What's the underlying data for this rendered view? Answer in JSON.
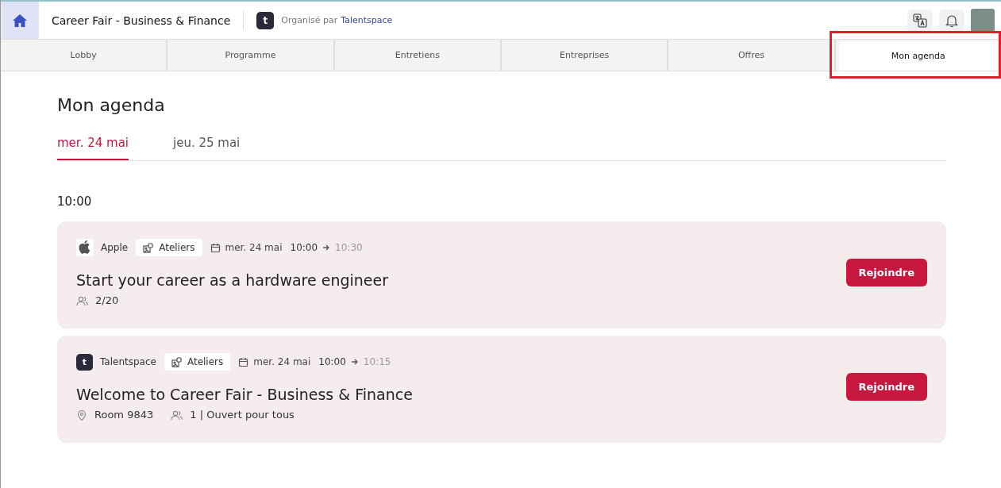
{
  "header": {
    "title": "Career Fair - Business & Finance",
    "organizer_prefix": "Organisé par",
    "organizer": "Talentspace",
    "logo_letter": "t"
  },
  "tabs": [
    {
      "label": "Lobby",
      "selected": false,
      "highlighted": false
    },
    {
      "label": "Programme",
      "selected": false,
      "highlighted": false
    },
    {
      "label": "Entretiens",
      "selected": false,
      "highlighted": false
    },
    {
      "label": "Entreprises",
      "selected": false,
      "highlighted": false
    },
    {
      "label": "Offres",
      "selected": false,
      "highlighted": false
    },
    {
      "label": "Mon agenda",
      "selected": true,
      "highlighted": true
    }
  ],
  "page_title": "Mon agenda",
  "day_tabs": [
    {
      "label": "mer. 24 mai",
      "selected": true
    },
    {
      "label": "jeu. 25 mai",
      "selected": false
    }
  ],
  "time_slot": "10:00",
  "sessions": [
    {
      "kind": "apple",
      "company": "Apple",
      "tag": "Ateliers",
      "date": "mer. 24 mai",
      "start": "10:00",
      "end": "10:30",
      "title": "Start your career as a hardware engineer",
      "meta": [
        {
          "kind": "attendees",
          "text": "2/20"
        }
      ],
      "button": "Rejoindre"
    },
    {
      "kind": "talentspace",
      "logo_letter": "t",
      "company": "Talentspace",
      "tag": "Ateliers",
      "date": "mer. 24 mai",
      "start": "10:00",
      "end": "10:15",
      "title": "Welcome to Career Fair - Business & Finance",
      "meta": [
        {
          "kind": "room",
          "text": "Room 9843"
        },
        {
          "kind": "attendees",
          "text": "1 | Ouvert pour tous"
        }
      ],
      "button": "Rejoindre"
    }
  ]
}
